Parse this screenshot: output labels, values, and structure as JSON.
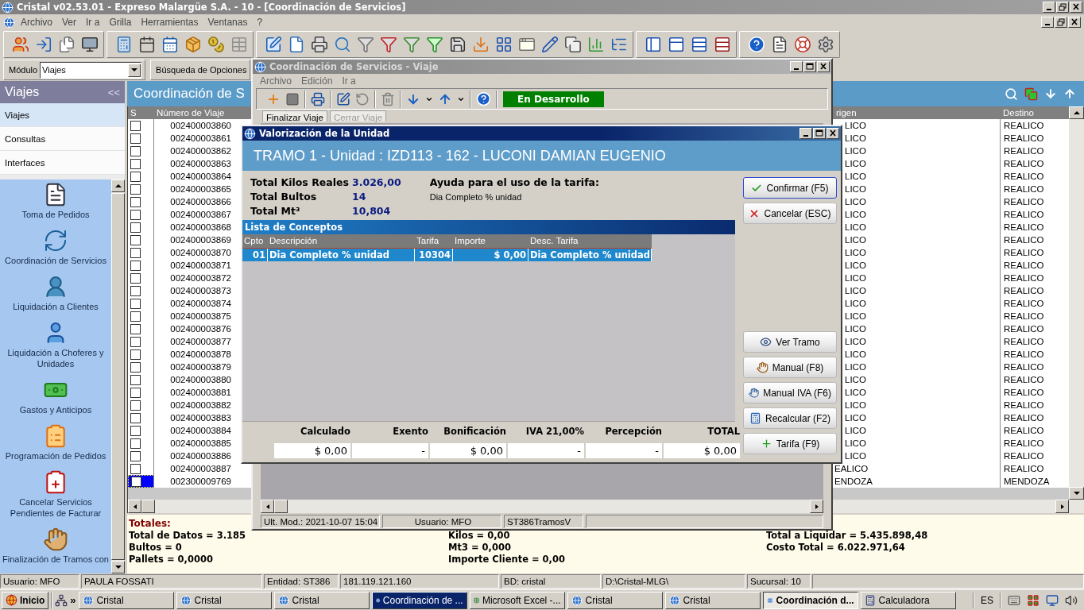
{
  "app": {
    "title": "Cristal v02.53.01 - Expreso Malargüe S.A. - 10 - [Coordinación de Servicios]",
    "menu": [
      "Archivo",
      "Ver",
      "Ir a",
      "Grilla",
      "Herramientas",
      "Ventanas",
      "?"
    ]
  },
  "module_bar": {
    "label": "Módulo",
    "value": "Viajes",
    "search_label": "Búsqueda de Opciones"
  },
  "sidebar": {
    "title": "Viajes",
    "collapse": "<<",
    "sections": [
      {
        "label": "Viajes",
        "selected": true
      },
      {
        "label": "Consultas",
        "selected": false
      },
      {
        "label": "Interfaces",
        "selected": false
      }
    ],
    "items": [
      "Toma de Pedidos",
      "Coordinación de Servicios",
      "Liquidación a Clientes",
      "Liquidación a Choferes y Unidades",
      "Gastos y Anticipos",
      "Programación de Pedidos",
      "Cancelar Servicios Pendientes de Facturar",
      "Finalización de Tramos con"
    ]
  },
  "grid": {
    "title": "Coordinación de S",
    "columns": [
      "S",
      "Número de Viaje",
      "rigen",
      "Destino"
    ],
    "rows": [
      {
        "number": "002400003860",
        "origin": "LICO",
        "destination": "REALICO",
        "checked": false,
        "selected": false
      },
      {
        "number": "002400003861",
        "origin": "LICO",
        "destination": "REALICO",
        "checked": false,
        "selected": false
      },
      {
        "number": "002400003862",
        "origin": "LICO",
        "destination": "REALICO",
        "checked": false,
        "selected": false
      },
      {
        "number": "002400003863",
        "origin": "LICO",
        "destination": "REALICO",
        "checked": false,
        "selected": false
      },
      {
        "number": "002400003864",
        "origin": "LICO",
        "destination": "REALICO",
        "checked": false,
        "selected": false
      },
      {
        "number": "002400003865",
        "origin": "LICO",
        "destination": "REALICO",
        "checked": false,
        "selected": false
      },
      {
        "number": "002400003866",
        "origin": "LICO",
        "destination": "REALICO",
        "checked": false,
        "selected": false
      },
      {
        "number": "002400003867",
        "origin": "LICO",
        "destination": "REALICO",
        "checked": false,
        "selected": false
      },
      {
        "number": "002400003868",
        "origin": "LICO",
        "destination": "REALICO",
        "checked": false,
        "selected": false
      },
      {
        "number": "002400003869",
        "origin": "LICO",
        "destination": "REALICO",
        "checked": false,
        "selected": false
      },
      {
        "number": "002400003870",
        "origin": "LICO",
        "destination": "REALICO",
        "checked": false,
        "selected": false
      },
      {
        "number": "002400003871",
        "origin": "LICO",
        "destination": "REALICO",
        "checked": false,
        "selected": false
      },
      {
        "number": "002400003872",
        "origin": "LICO",
        "destination": "REALICO",
        "checked": false,
        "selected": false
      },
      {
        "number": "002400003873",
        "origin": "LICO",
        "destination": "REALICO",
        "checked": false,
        "selected": false
      },
      {
        "number": "002400003874",
        "origin": "LICO",
        "destination": "REALICO",
        "checked": false,
        "selected": false
      },
      {
        "number": "002400003875",
        "origin": "LICO",
        "destination": "REALICO",
        "checked": false,
        "selected": false
      },
      {
        "number": "002400003876",
        "origin": "LICO",
        "destination": "REALICO",
        "checked": false,
        "selected": false
      },
      {
        "number": "002400003877",
        "origin": "LICO",
        "destination": "REALICO",
        "checked": false,
        "selected": false
      },
      {
        "number": "002400003878",
        "origin": "LICO",
        "destination": "REALICO",
        "checked": false,
        "selected": false
      },
      {
        "number": "002400003879",
        "origin": "LICO",
        "destination": "REALICO",
        "checked": false,
        "selected": false
      },
      {
        "number": "002400003880",
        "origin": "LICO",
        "destination": "REALICO",
        "checked": false,
        "selected": false
      },
      {
        "number": "002400003881",
        "origin": "LICO",
        "destination": "REALICO",
        "checked": false,
        "selected": false
      },
      {
        "number": "002400003882",
        "origin": "LICO",
        "destination": "REALICO",
        "checked": false,
        "selected": false
      },
      {
        "number": "002400003883",
        "origin": "LICO",
        "destination": "REALICO",
        "checked": false,
        "selected": false
      },
      {
        "number": "002400003884",
        "origin": "LICO",
        "destination": "REALICO",
        "checked": false,
        "selected": false
      },
      {
        "number": "002400003885",
        "origin": "LICO",
        "destination": "REALICO",
        "checked": false,
        "selected": false
      },
      {
        "number": "002400003886",
        "origin": "LICO",
        "destination": "REALICO",
        "checked": false,
        "selected": false
      },
      {
        "number": "002400003887",
        "origin": "EALICO",
        "destination": "REALICO",
        "checked": false,
        "selected": false
      },
      {
        "number": "002300009769",
        "origin": "ENDOZA",
        "destination": "MENDOZA",
        "checked": false,
        "selected": true
      }
    ]
  },
  "totals": {
    "title": "Totales:",
    "columns": [
      [
        "Total de Datos = 3.185",
        "Bultos = 0",
        "Pallets = 0,0000"
      ],
      [
        "Kilos = 0,00",
        "Mt3 = 0,000",
        "Importe Cliente = 0,00"
      ],
      [
        "Total a Liquidar = 5.435.898,48",
        "Costo Total = 6.022.971,64"
      ]
    ]
  },
  "status_bar": [
    "Usuario: MFO",
    "PAULA FOSSATI",
    "Entidad: ST386",
    "181.119.121.160",
    "BD: cristal",
    "D:\\Cristal-MLG\\",
    "Sucursal: 10"
  ],
  "taskbar": {
    "start": "Inicio",
    "more": "»",
    "language": "ES",
    "tasks": [
      {
        "label": "Cristal",
        "selected": false,
        "flashing": false
      },
      {
        "label": "Cristal",
        "selected": false,
        "flashing": false
      },
      {
        "label": "Cristal",
        "selected": false,
        "flashing": false
      },
      {
        "label": "Coordinación de ...",
        "selected": false,
        "flashing": true
      },
      {
        "label": "Microsoft Excel -...",
        "selected": false,
        "flashing": false
      },
      {
        "label": "Cristal",
        "selected": false,
        "flashing": false
      },
      {
        "label": "Cristal",
        "selected": false,
        "flashing": false
      },
      {
        "label": "Coordinación d...",
        "selected": true,
        "flashing": false
      },
      {
        "label": "Calculadora",
        "selected": false,
        "flashing": false
      }
    ]
  },
  "trip_window": {
    "title": "Coordinación de Servicios - Viaje",
    "menu": [
      "Archivo",
      "Edición",
      "Ir a"
    ],
    "badge": "En Desarrollo",
    "tabs": [
      {
        "label": "Finalizar Viaje",
        "disabled": false
      },
      {
        "label": "Cerrar Viaje",
        "disabled": true
      }
    ],
    "status": [
      "Ult. Mod.: 2021-10-07 15:04",
      "Usuario: MFO",
      "ST386TramosV"
    ]
  },
  "dialog": {
    "title": "Valorización de la Unidad",
    "header": "TRAMO 1 - Unidad : IZD113 - 162 - LUCONI DAMIAN EUGENIO",
    "stats": [
      {
        "label": "Total Kilos Reales",
        "value": "3.026,00"
      },
      {
        "label": "Total Bultos",
        "value": "14"
      },
      {
        "label": "Total Mt³",
        "value": "10,804"
      }
    ],
    "help_title": "Ayuda para el uso de la tarifa:",
    "help_text": "Dia Completo % unidad",
    "list_title": "Lista de Conceptos",
    "columns": [
      "Cpto",
      "Descripción",
      "Tarifa",
      "Importe",
      "Desc. Tarifa"
    ],
    "rows": [
      {
        "cells": [
          "01",
          "Dia Completo % unidad",
          "10304",
          "$ 0,00",
          "Dia Completo % unidad"
        ],
        "selected": true
      }
    ],
    "summary": [
      {
        "label": "Calculado",
        "value": "$ 0,00"
      },
      {
        "label": "Exento",
        "value": "-"
      },
      {
        "label": "Bonificación",
        "value": "$ 0,00"
      },
      {
        "label": "IVA 21,00%",
        "value": "-"
      },
      {
        "label": "Percepción",
        "value": "-"
      },
      {
        "label": "TOTAL",
        "value": "$ 0,00"
      }
    ],
    "buttons": [
      {
        "label": "Confirmar (F5)",
        "focused": true
      },
      {
        "label": "Cancelar (ESC)",
        "focused": false
      }
    ],
    "side_buttons": [
      "Ver Tramo",
      "Manual (F8)",
      "Manual IVA (F6)",
      "Recalcular (F2)",
      "Tarifa (F9)"
    ]
  }
}
